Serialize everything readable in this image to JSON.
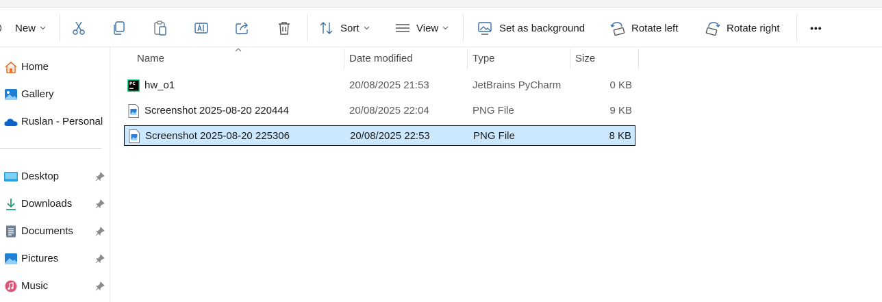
{
  "toolbar": {
    "new_label": "New",
    "sort_label": "Sort",
    "view_label": "View",
    "set_background_label": "Set as background",
    "rotate_left_label": "Rotate left",
    "rotate_right_label": "Rotate right",
    "more_label": "•••"
  },
  "sidebar": {
    "items": [
      {
        "label": "Home",
        "icon": "home-icon",
        "pinned": false
      },
      {
        "label": "Gallery",
        "icon": "gallery-icon",
        "pinned": false
      },
      {
        "label": "Ruslan - Personal",
        "icon": "onedrive-icon",
        "pinned": false
      },
      {
        "label": "Desktop",
        "icon": "desktop-icon",
        "pinned": true
      },
      {
        "label": "Downloads",
        "icon": "downloads-icon",
        "pinned": true
      },
      {
        "label": "Documents",
        "icon": "documents-icon",
        "pinned": true
      },
      {
        "label": "Pictures",
        "icon": "pictures-icon",
        "pinned": true
      },
      {
        "label": "Music",
        "icon": "music-icon",
        "pinned": true
      }
    ]
  },
  "columns": {
    "name": "Name",
    "date_modified": "Date modified",
    "type": "Type",
    "size": "Size"
  },
  "files": [
    {
      "name": "hw_o1",
      "date": "20/08/2025 21:53",
      "type": "JetBrains PyCharm",
      "size": "0 KB",
      "icon": "pycharm-file-icon",
      "selected": false
    },
    {
      "name": "Screenshot 2025-08-20 220444",
      "date": "20/08/2025 22:04",
      "type": "PNG File",
      "size": "9 KB",
      "icon": "png-file-icon",
      "selected": false
    },
    {
      "name": "Screenshot 2025-08-20 225306",
      "date": "20/08/2025 22:53",
      "type": "PNG File",
      "size": "8 KB",
      "icon": "png-file-icon",
      "selected": true
    }
  ],
  "colors": {
    "selection_bg": "#cce8ff",
    "accent": "#0067c0"
  }
}
